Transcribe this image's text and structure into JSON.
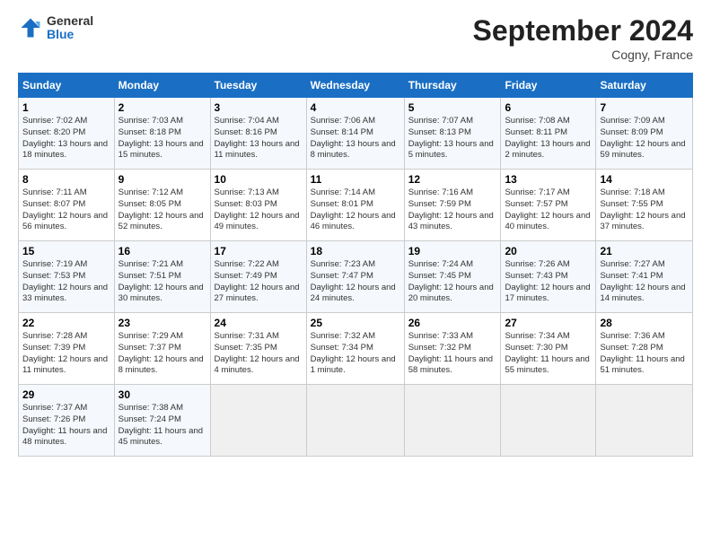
{
  "header": {
    "logo_general": "General",
    "logo_blue": "Blue",
    "month_title": "September 2024",
    "location": "Cogny, France"
  },
  "days_of_week": [
    "Sunday",
    "Monday",
    "Tuesday",
    "Wednesday",
    "Thursday",
    "Friday",
    "Saturday"
  ],
  "weeks": [
    [
      {
        "day": "1",
        "info": "Sunrise: 7:02 AM\nSunset: 8:20 PM\nDaylight: 13 hours and 18 minutes."
      },
      {
        "day": "2",
        "info": "Sunrise: 7:03 AM\nSunset: 8:18 PM\nDaylight: 13 hours and 15 minutes."
      },
      {
        "day": "3",
        "info": "Sunrise: 7:04 AM\nSunset: 8:16 PM\nDaylight: 13 hours and 11 minutes."
      },
      {
        "day": "4",
        "info": "Sunrise: 7:06 AM\nSunset: 8:14 PM\nDaylight: 13 hours and 8 minutes."
      },
      {
        "day": "5",
        "info": "Sunrise: 7:07 AM\nSunset: 8:13 PM\nDaylight: 13 hours and 5 minutes."
      },
      {
        "day": "6",
        "info": "Sunrise: 7:08 AM\nSunset: 8:11 PM\nDaylight: 13 hours and 2 minutes."
      },
      {
        "day": "7",
        "info": "Sunrise: 7:09 AM\nSunset: 8:09 PM\nDaylight: 12 hours and 59 minutes."
      }
    ],
    [
      {
        "day": "8",
        "info": "Sunrise: 7:11 AM\nSunset: 8:07 PM\nDaylight: 12 hours and 56 minutes."
      },
      {
        "day": "9",
        "info": "Sunrise: 7:12 AM\nSunset: 8:05 PM\nDaylight: 12 hours and 52 minutes."
      },
      {
        "day": "10",
        "info": "Sunrise: 7:13 AM\nSunset: 8:03 PM\nDaylight: 12 hours and 49 minutes."
      },
      {
        "day": "11",
        "info": "Sunrise: 7:14 AM\nSunset: 8:01 PM\nDaylight: 12 hours and 46 minutes."
      },
      {
        "day": "12",
        "info": "Sunrise: 7:16 AM\nSunset: 7:59 PM\nDaylight: 12 hours and 43 minutes."
      },
      {
        "day": "13",
        "info": "Sunrise: 7:17 AM\nSunset: 7:57 PM\nDaylight: 12 hours and 40 minutes."
      },
      {
        "day": "14",
        "info": "Sunrise: 7:18 AM\nSunset: 7:55 PM\nDaylight: 12 hours and 37 minutes."
      }
    ],
    [
      {
        "day": "15",
        "info": "Sunrise: 7:19 AM\nSunset: 7:53 PM\nDaylight: 12 hours and 33 minutes."
      },
      {
        "day": "16",
        "info": "Sunrise: 7:21 AM\nSunset: 7:51 PM\nDaylight: 12 hours and 30 minutes."
      },
      {
        "day": "17",
        "info": "Sunrise: 7:22 AM\nSunset: 7:49 PM\nDaylight: 12 hours and 27 minutes."
      },
      {
        "day": "18",
        "info": "Sunrise: 7:23 AM\nSunset: 7:47 PM\nDaylight: 12 hours and 24 minutes."
      },
      {
        "day": "19",
        "info": "Sunrise: 7:24 AM\nSunset: 7:45 PM\nDaylight: 12 hours and 20 minutes."
      },
      {
        "day": "20",
        "info": "Sunrise: 7:26 AM\nSunset: 7:43 PM\nDaylight: 12 hours and 17 minutes."
      },
      {
        "day": "21",
        "info": "Sunrise: 7:27 AM\nSunset: 7:41 PM\nDaylight: 12 hours and 14 minutes."
      }
    ],
    [
      {
        "day": "22",
        "info": "Sunrise: 7:28 AM\nSunset: 7:39 PM\nDaylight: 12 hours and 11 minutes."
      },
      {
        "day": "23",
        "info": "Sunrise: 7:29 AM\nSunset: 7:37 PM\nDaylight: 12 hours and 8 minutes."
      },
      {
        "day": "24",
        "info": "Sunrise: 7:31 AM\nSunset: 7:35 PM\nDaylight: 12 hours and 4 minutes."
      },
      {
        "day": "25",
        "info": "Sunrise: 7:32 AM\nSunset: 7:34 PM\nDaylight: 12 hours and 1 minute."
      },
      {
        "day": "26",
        "info": "Sunrise: 7:33 AM\nSunset: 7:32 PM\nDaylight: 11 hours and 58 minutes."
      },
      {
        "day": "27",
        "info": "Sunrise: 7:34 AM\nSunset: 7:30 PM\nDaylight: 11 hours and 55 minutes."
      },
      {
        "day": "28",
        "info": "Sunrise: 7:36 AM\nSunset: 7:28 PM\nDaylight: 11 hours and 51 minutes."
      }
    ],
    [
      {
        "day": "29",
        "info": "Sunrise: 7:37 AM\nSunset: 7:26 PM\nDaylight: 11 hours and 48 minutes."
      },
      {
        "day": "30",
        "info": "Sunrise: 7:38 AM\nSunset: 7:24 PM\nDaylight: 11 hours and 45 minutes."
      },
      {
        "day": "",
        "info": ""
      },
      {
        "day": "",
        "info": ""
      },
      {
        "day": "",
        "info": ""
      },
      {
        "day": "",
        "info": ""
      },
      {
        "day": "",
        "info": ""
      }
    ]
  ]
}
